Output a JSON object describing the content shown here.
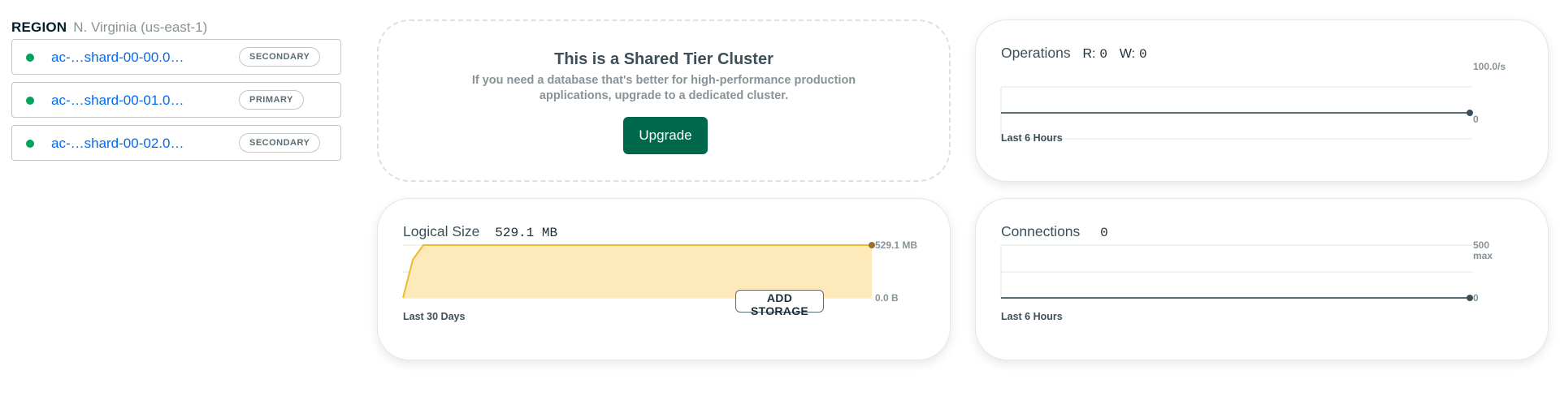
{
  "region": {
    "label": "REGION",
    "value": "N. Virginia (us-east-1)"
  },
  "nodes": [
    {
      "name": "ac-…shard-00-00.0…",
      "role": "SECONDARY",
      "status": "healthy"
    },
    {
      "name": "ac-…shard-00-01.0…",
      "role": "PRIMARY",
      "status": "healthy"
    },
    {
      "name": "ac-…shard-00-02.0…",
      "role": "SECONDARY",
      "status": "healthy"
    }
  ],
  "promo": {
    "title": "This is a Shared Tier Cluster",
    "text": "If you need a database that's better for high-performance production applications, upgrade to a dedicated cluster.",
    "button": "Upgrade"
  },
  "operations": {
    "title": "Operations",
    "r_label": "R:",
    "r_value": "0",
    "w_label": "W:",
    "w_value": "0",
    "max_label": "100.0/s",
    "min_label": "0",
    "period": "Last 6 Hours"
  },
  "logical_size": {
    "title": "Logical Size",
    "value": "529.1 MB",
    "max_label": "529.1 MB",
    "min_label": "0.0 B",
    "period": "Last 30 Days",
    "button": "ADD STORAGE"
  },
  "connections": {
    "title": "Connections",
    "value": "0",
    "max_label": "500",
    "max_suffix": "max",
    "min_label": "0",
    "period": "Last 6 Hours"
  },
  "colors": {
    "accent_green": "#00684a",
    "status_green": "#00a35c",
    "link_blue": "#016bf8",
    "storage_line": "#ecbc2e",
    "storage_fill": "#fde9b9",
    "storage_dot": "#9c6f2f",
    "metric_line": "#5c6c75"
  },
  "chart_data": [
    {
      "type": "line",
      "title": "Operations",
      "series": [
        {
          "name": "R",
          "values": [
            0,
            0
          ]
        },
        {
          "name": "W",
          "values": [
            0,
            0
          ]
        }
      ],
      "ylim": [
        0,
        100
      ],
      "ytick_labels": [
        "0",
        "100.0/s"
      ]
    },
    {
      "type": "area",
      "title": "Logical Size",
      "x": [
        0,
        0.02,
        0.045,
        1
      ],
      "y": [
        0,
        382,
        529.1,
        529.1
      ],
      "ylim": [
        0,
        529.1
      ],
      "ytick_labels": [
        "0.0 B",
        "529.1 MB"
      ],
      "unit": "MB"
    },
    {
      "type": "line",
      "title": "Connections",
      "series": [
        {
          "values": [
            0,
            0
          ]
        }
      ],
      "ylim": [
        0,
        500
      ],
      "ytick_labels": [
        "0",
        "500 max"
      ]
    }
  ]
}
